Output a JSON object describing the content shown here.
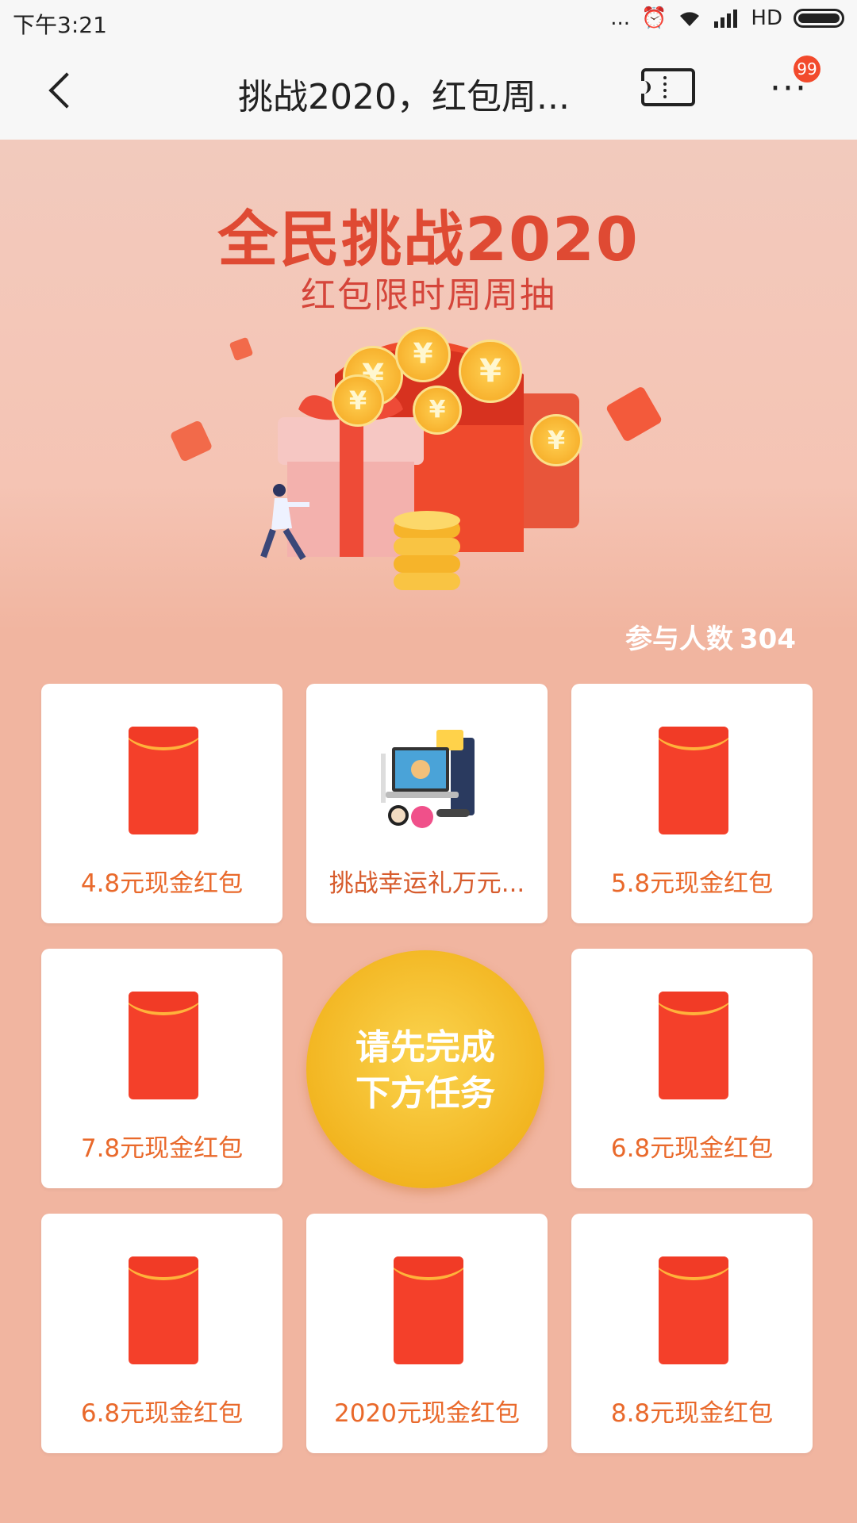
{
  "status_bar": {
    "time": "下午3:21",
    "signal_dots": "...",
    "hd_label": "HD"
  },
  "header": {
    "title": "挑战2020，红包周...",
    "more_label": "···",
    "badge_count": "99"
  },
  "hero": {
    "title": "全民挑战2020",
    "subtitle": "红包限时周周抽",
    "currency_symbol": "¥"
  },
  "participants": {
    "label": "参与人数",
    "count": "304"
  },
  "grid": {
    "tiles": [
      {
        "label": "4.8元现金红包",
        "type": "red-envelope"
      },
      {
        "label": "挑战幸运礼万元...",
        "type": "prize-bundle"
      },
      {
        "label": "5.8元现金红包",
        "type": "red-envelope"
      },
      {
        "label": "7.8元现金红包",
        "type": "red-envelope"
      },
      {
        "label": "6.8元现金红包",
        "type": "red-envelope"
      },
      {
        "label": "6.8元现金红包",
        "type": "red-envelope"
      },
      {
        "label": "2020元现金红包",
        "type": "red-envelope"
      },
      {
        "label": "8.8元现金红包",
        "type": "red-envelope"
      }
    ],
    "center_button": {
      "line1": "请先完成",
      "line2": "下方任务"
    }
  },
  "colors": {
    "accent": "#df4a33",
    "envelope": "#f4402a",
    "button": "#f2b520",
    "label": "#e9692b"
  }
}
